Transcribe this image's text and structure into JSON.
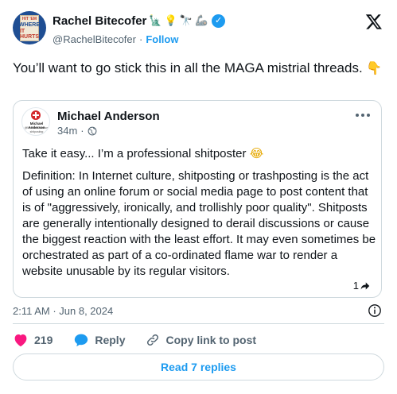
{
  "author": {
    "display_name": "Rachel Bitecofer",
    "handle": "@RachelBitecofer",
    "separator": "·",
    "follow_label": "Follow",
    "avatar_book": {
      "line1": "HIT 'EM",
      "line2": "WHERE",
      "line3": "IT HURTS"
    },
    "name_emojis": [
      "🗽",
      "💡",
      "🔭",
      "🦾"
    ]
  },
  "tweet": {
    "text": "You’ll want to go stick this in all the MAGA mistrial threads.",
    "trailing_emoji": "👇",
    "timestamp": "2:11 AM · Jun 8, 2024"
  },
  "quoted": {
    "display_name": "Michael Anderson",
    "time": "34m",
    "dot": "·",
    "avatar_lines": {
      "line1": "Michael Anderson",
      "line2": "@MichaelAnderson",
      "line3": "shitposting"
    },
    "line1": "Take it easy... I’m a professional shitposter",
    "line1_emoji": "😂",
    "body": "Definition: In Internet culture, shitposting or trashposting is the act of using an online forum or social media page to post content that is of \"aggressively, ironically, and trollishly poor quality\". Shitposts are generally intentionally designed to derail discussions or cause the biggest reaction with the least effort. It may even sometimes be orchestrated as part of a co-ordinated flame war to render a website unusable by its regular visitors.",
    "share_count": "1"
  },
  "actions": {
    "like_count": "219",
    "reply_label": "Reply",
    "copy_link_label": "Copy link to post"
  },
  "read_replies_label": "Read 7 replies",
  "colors": {
    "accent": "#1d9bf0",
    "like_red": "#f91880",
    "text": "#0f1419",
    "muted": "#536471",
    "border": "#cfd9de"
  }
}
